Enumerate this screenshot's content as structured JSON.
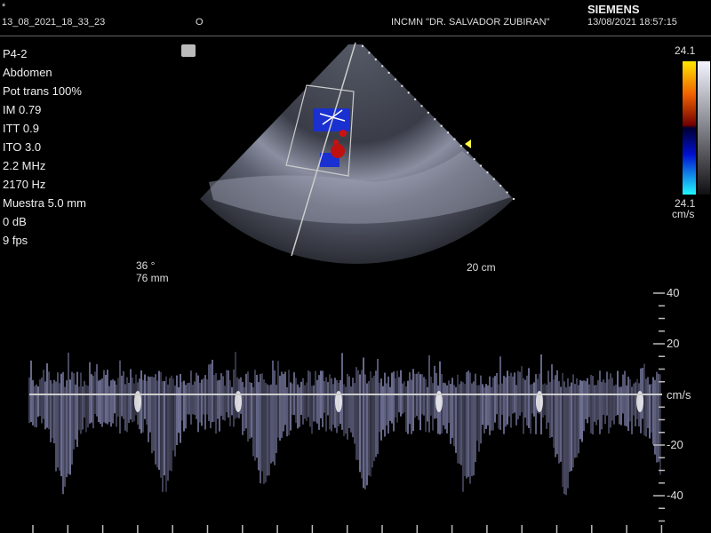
{
  "header": {
    "marker": "*",
    "study_id": "13_08_2021_18_33_23",
    "operator": "O",
    "institution": "INCMN \"DR. SALVADOR ZUBIRAN\"",
    "brand": "SIEMENS",
    "datetime": "13/08/2021 18:57:15"
  },
  "params": [
    "P4-2",
    "Abdomen",
    "Pot trans 100%",
    "IM 0.79",
    "ITT 0.9",
    "ITO 3.0",
    "2.2 MHz",
    "2170 Hz",
    "Muestra 5.0 mm",
    "0 dB",
    "9 fps"
  ],
  "image": {
    "angle": "36 °",
    "gate_depth": "76 mm",
    "depth": "20 cm"
  },
  "color_bar": {
    "top_label": "24.1",
    "bottom_label": "24.1",
    "unit": "cm/s",
    "colors": {
      "positive_top": "#ffe600",
      "positive_mid": "#e03000",
      "negative_mid": "#0010c0",
      "negative_bottom": "#20f0ff"
    }
  },
  "spectral_scale": {
    "unit": "cm/s",
    "labels": [
      "40",
      "20",
      "-20",
      "-40"
    ],
    "values": [
      40,
      20,
      -20,
      -40
    ],
    "range": [
      -50,
      40
    ]
  }
}
